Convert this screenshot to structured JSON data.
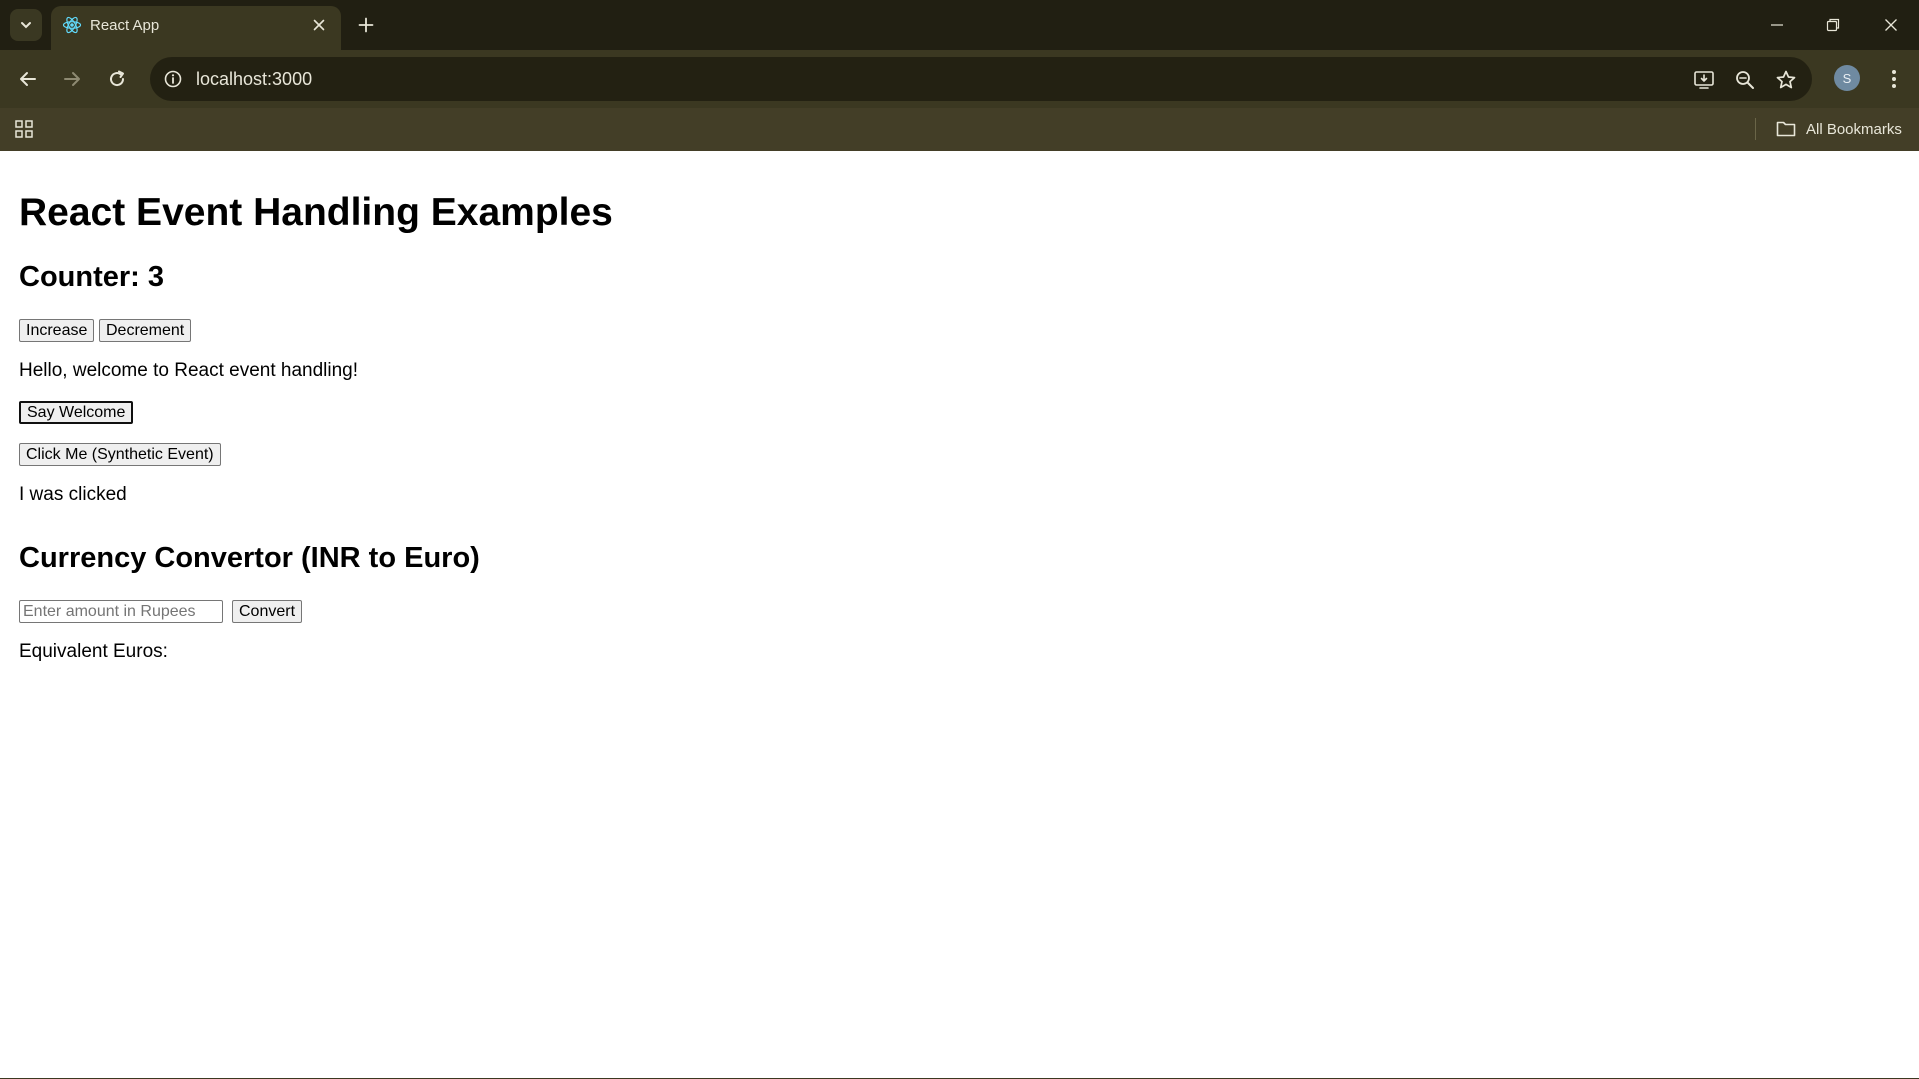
{
  "browser": {
    "tab_title": "React App",
    "url": "localhost:3000",
    "avatar_letter": "S",
    "bookmarks_label": "All Bookmarks",
    "colors": {
      "tabstrip": "#211f12",
      "toolbar": "#3b3821",
      "bookmarks_bar": "#433e27"
    }
  },
  "page": {
    "heading": "React Event Handling Examples",
    "counter_label": "Counter: 3",
    "increase_label": "Increase",
    "decrement_label": "Decrement",
    "welcome_text": "Hello, welcome to React event handling!",
    "say_welcome_label": "Say Welcome",
    "synthetic_label": "Click Me (Synthetic Event)",
    "clicked_text": "I was clicked",
    "currency_heading": "Currency Convertor (INR to Euro)",
    "rupee_input": {
      "value": "",
      "placeholder": "Enter amount in Rupees"
    },
    "convert_label": "Convert",
    "euros_text": "Equivalent Euros:"
  }
}
